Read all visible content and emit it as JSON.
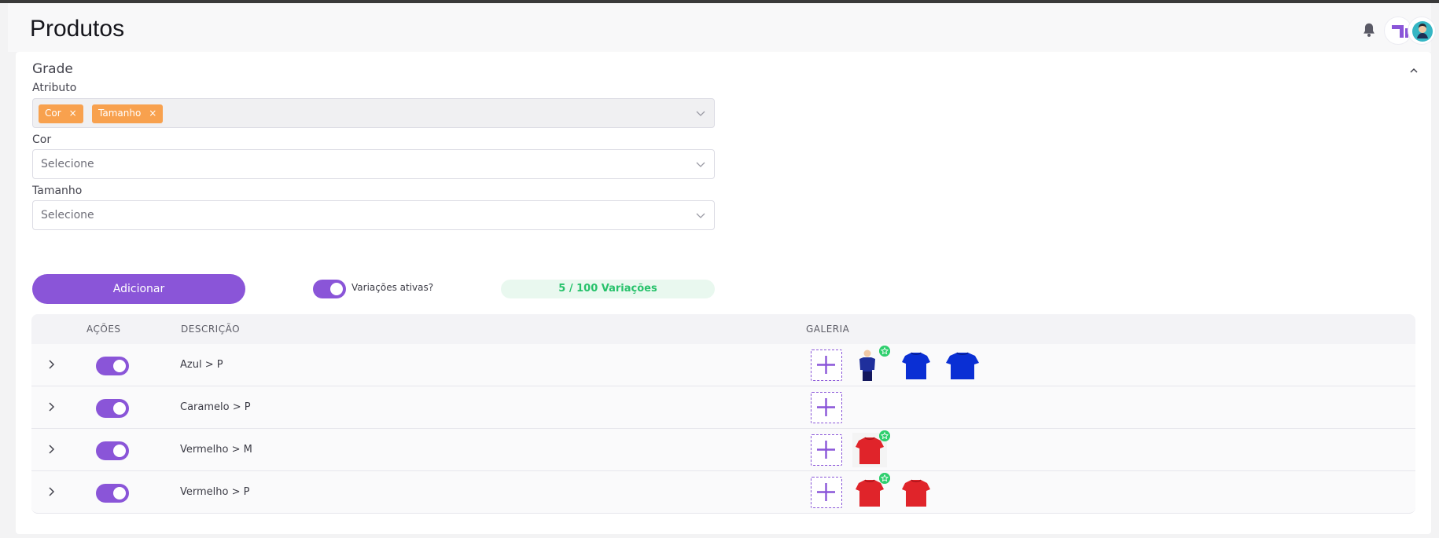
{
  "header": {
    "title": "Produtos"
  },
  "card": {
    "title": "Grade",
    "atributo": {
      "label": "Atributo",
      "tags": [
        "Cor",
        "Tamanho"
      ],
      "remove_glyph": "×"
    },
    "cor": {
      "label": "Cor",
      "placeholder": "Selecione"
    },
    "tamanho": {
      "label": "Tamanho",
      "placeholder": "Selecione"
    },
    "add_button": "Adicionar",
    "active_toggle": {
      "label": "Variações ativas?",
      "on": true
    },
    "variations_count": "5 / 100 Variações"
  },
  "table": {
    "headers": {
      "acoes": "AÇÕES",
      "descricao": "DESCRIÇÃO",
      "galeria": "GALERIA"
    },
    "rows": [
      {
        "descricao": "Azul > P",
        "active": true,
        "images": [
          "blue-shirt-model",
          "blue-shirt",
          "blue-shirt"
        ],
        "featured_image": 0
      },
      {
        "descricao": "Caramelo > P",
        "active": true,
        "images": [],
        "featured_image": null
      },
      {
        "descricao": "Vermelho > M",
        "active": true,
        "images": [
          "red-shirt"
        ],
        "featured_image": 0
      },
      {
        "descricao": "Vermelho > P",
        "active": true,
        "images": [
          "red-shirt",
          "red-shirt"
        ],
        "featured_image": 0
      }
    ]
  },
  "colors": {
    "accent": "#8a55d8",
    "tag": "#f8a14e",
    "success": "#27c26b",
    "star": "#2fcf6e",
    "blue_shirt": "#0a2fd4",
    "red_shirt": "#e0242a"
  },
  "icons": {
    "bell": "bell-icon",
    "collapse": "chevron-up-icon",
    "select": "chevron-down-icon",
    "expand_row": "chevron-right-icon",
    "add_image": "plus-icon",
    "featured": "star-icon"
  }
}
